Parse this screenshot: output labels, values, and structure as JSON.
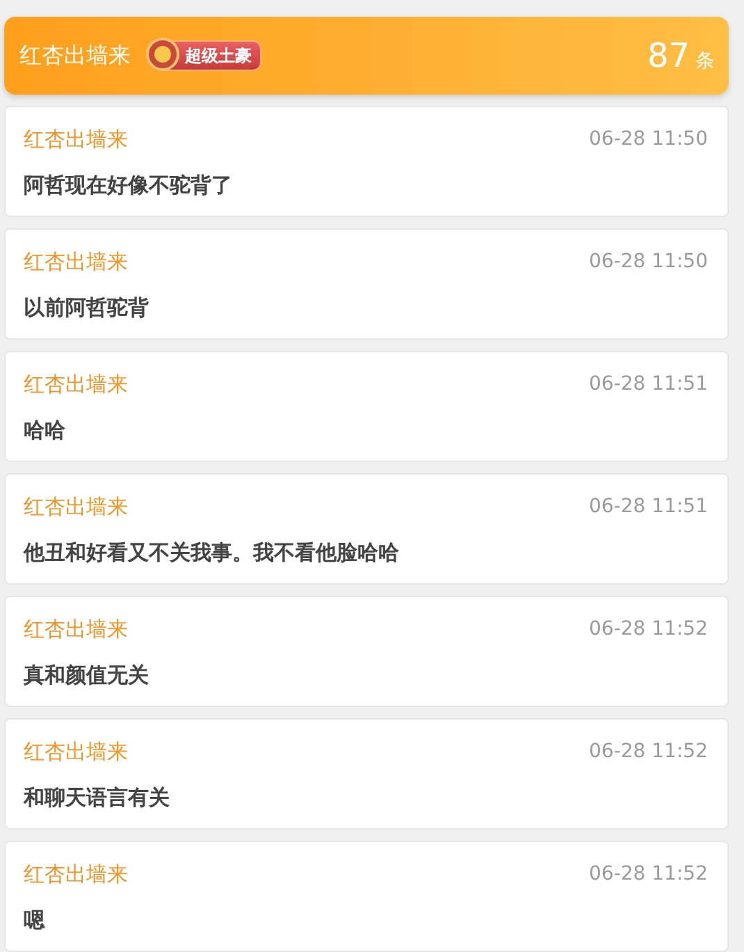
{
  "header": {
    "username": "红杏出墙来",
    "badge": "超级土豪",
    "count": "87",
    "count_unit": "条"
  },
  "messages": [
    {
      "author": "红杏出墙来",
      "time": "06-28 11:50",
      "text": "阿哲现在好像不驼背了"
    },
    {
      "author": "红杏出墙来",
      "time": "06-28 11:50",
      "text": "以前阿哲驼背"
    },
    {
      "author": "红杏出墙来",
      "time": "06-28 11:51",
      "text": "哈哈"
    },
    {
      "author": "红杏出墙来",
      "time": "06-28 11:51",
      "text": "他丑和好看又不关我事。我不看他脸哈哈"
    },
    {
      "author": "红杏出墙来",
      "time": "06-28 11:52",
      "text": "真和颜值无关"
    },
    {
      "author": "红杏出墙来",
      "time": "06-28 11:52",
      "text": "和聊天语言有关"
    },
    {
      "author": "红杏出墙来",
      "time": "06-28 11:52",
      "text": "嗯"
    }
  ]
}
